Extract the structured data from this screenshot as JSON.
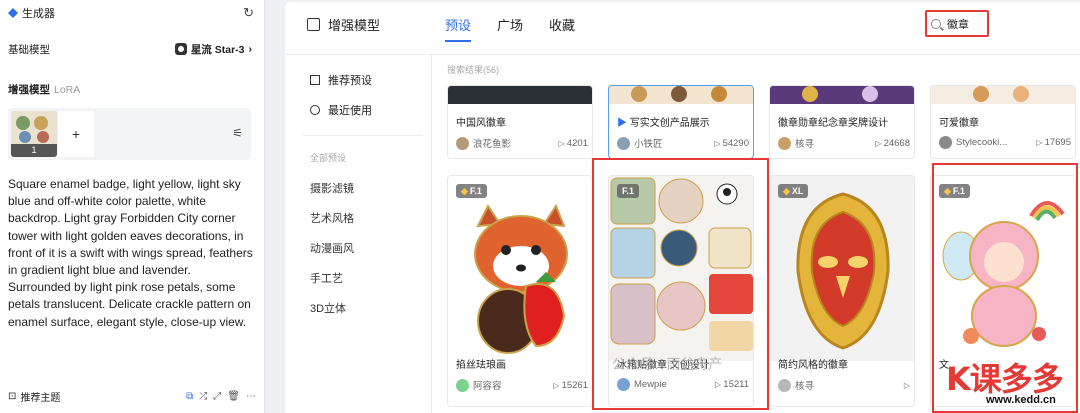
{
  "left_panel": {
    "header": "生成器",
    "base_model_label": "基础模型",
    "base_model_value": "星流 Star-3",
    "lora_label": "增强模型",
    "lora_suffix": "LoRA",
    "lora_count": "1",
    "add_symbol": "+",
    "prompt": "Square enamel badge, light yellow, light sky blue and off-white color palette, white backdrop. Light gray Forbidden City corner tower with light golden eaves decorations, in front of it is a swift with wings spread, feathers in gradient light blue and lavender. Surrounded by light pink rose petals, some petals translucent. Delicate crackle pattern on enamel surface, elegant style, close-up view.",
    "footer_label": "推荐主题"
  },
  "window": {
    "title": "增强模型",
    "tabs": [
      "预设",
      "广场",
      "收藏"
    ],
    "search_value": "徽章",
    "nav": {
      "recommended": "推荐预设",
      "recent": "最近使用",
      "group_label": "全部预设",
      "categories": [
        "摄影滤镜",
        "艺术风格",
        "动漫画风",
        "手工艺",
        "3D立体"
      ]
    },
    "result_count": "搜索结果(56)",
    "top_cards": [
      {
        "title": "中国风徽章",
        "author": "浪花鱼影",
        "views": "4201"
      },
      {
        "title": "写实文创产品展示",
        "author": "小铁匠",
        "views": "54290"
      },
      {
        "title": "徽章勋章纪念章奖牌设计",
        "author": "核寻",
        "views": "24668"
      },
      {
        "title": "可爱徽章",
        "author": "Stylecooki...",
        "views": "17695"
      }
    ],
    "bottom_cards": [
      {
        "tag": "F.1",
        "title": "掐丝珐琅画",
        "author": "阿容容",
        "views": "15261"
      },
      {
        "tag": "F.1",
        "title": "冰箱贴徽章 文创设计",
        "author": "Mewpie",
        "views": "15211"
      },
      {
        "tag": "XL",
        "title": "简约风格的徽章",
        "author": "核寻",
        "views": ""
      },
      {
        "tag": "F.1",
        "title": "文",
        "author": "",
        "views": ""
      }
    ]
  },
  "watermark": "公众号 · 雨盆舟产",
  "logo": {
    "brand": "K课多多",
    "url": "www.kedd.cn"
  }
}
